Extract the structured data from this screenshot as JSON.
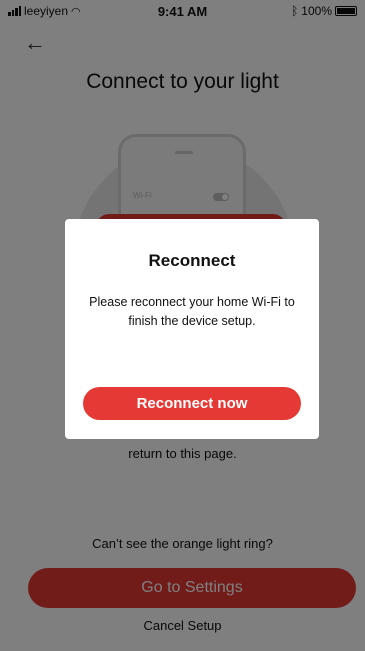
{
  "status_bar": {
    "carrier": "leeyiyen",
    "time": "9:41 AM",
    "battery": "100%",
    "battery_level": 1.0
  },
  "icons": {
    "back": "arrow-left-icon",
    "wifi": "wifi-icon",
    "signal": "signal-icon",
    "bluetooth": "bluetooth-icon",
    "battery": "battery-icon"
  },
  "header": {
    "back_glyph": "←",
    "title": "Connect to your light"
  },
  "illustration": {
    "wifi_label": "Wi-Fi"
  },
  "main": {
    "instruction_tail": "return to this page.",
    "help_text": "Can’t see the orange light ring?",
    "primary_button": "Go to Settings",
    "cancel": "Cancel Setup"
  },
  "dialog": {
    "title": "Reconnect",
    "body": "Please reconnect your home Wi-Fi to finish the device setup.",
    "button": "Reconnect now"
  },
  "colors": {
    "accent": "#e53935",
    "overlay": "rgba(0,0,0,0.5)"
  }
}
